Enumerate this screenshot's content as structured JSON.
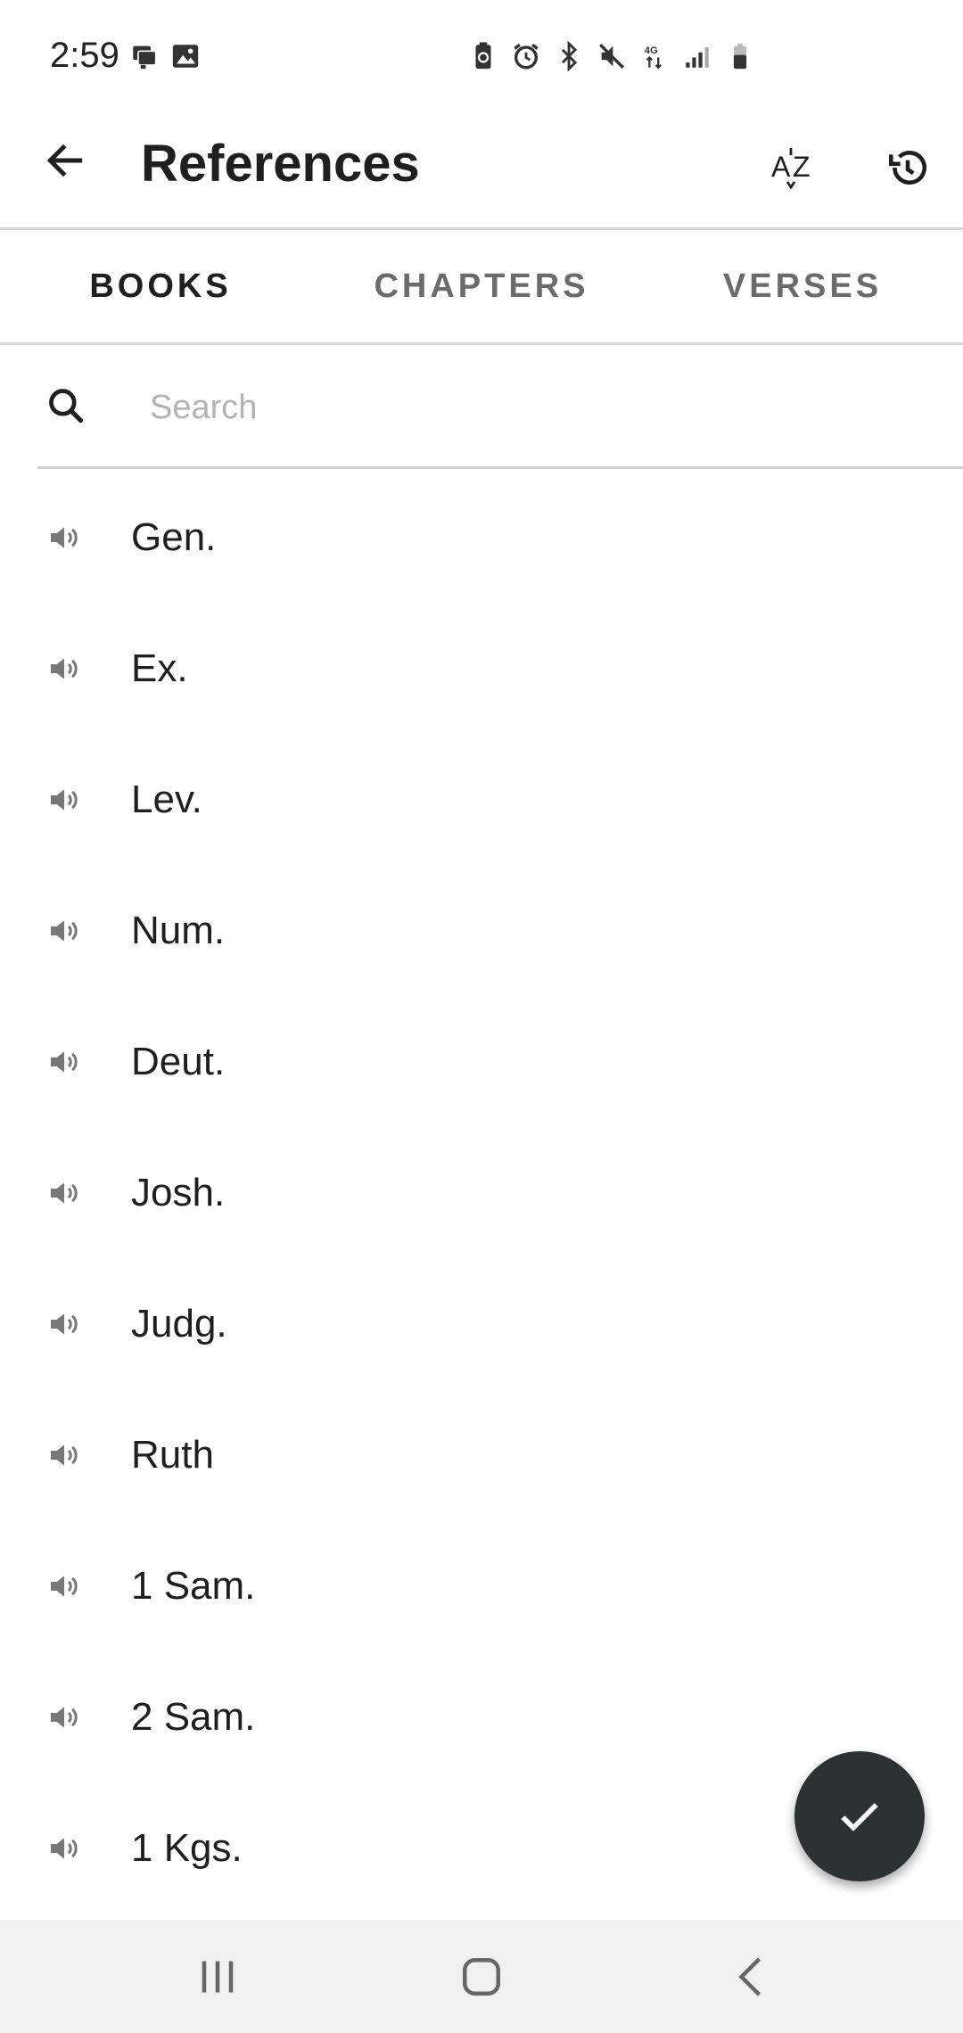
{
  "status_bar": {
    "time": "2:59",
    "left_icons": [
      "notification-icon",
      "image-icon"
    ],
    "right_icons": [
      "battery-saver-icon",
      "alarm-icon",
      "bluetooth-icon",
      "mute-icon",
      "network-4g-icon",
      "signal-icon",
      "battery-icon"
    ]
  },
  "app_bar": {
    "title": "References",
    "back_icon": "arrow-back-icon",
    "sort_icon": "sort-az-icon",
    "history_icon": "history-icon"
  },
  "tabs": [
    {
      "label": "BOOKS",
      "active": true
    },
    {
      "label": "CHAPTERS",
      "active": false
    },
    {
      "label": "VERSES",
      "active": false
    }
  ],
  "search": {
    "placeholder": "Search",
    "value": ""
  },
  "books": [
    {
      "label": "Gen."
    },
    {
      "label": "Ex."
    },
    {
      "label": "Lev."
    },
    {
      "label": "Num."
    },
    {
      "label": "Deut."
    },
    {
      "label": "Josh."
    },
    {
      "label": "Judg."
    },
    {
      "label": "Ruth"
    },
    {
      "label": "1 Sam."
    },
    {
      "label": "2 Sam."
    },
    {
      "label": "1 Kgs."
    }
  ],
  "fab": {
    "icon": "check-icon"
  },
  "colors": {
    "fab_bg": "#2d3132",
    "divider": "#d4d4d4",
    "active_tab": "#1f1f1f",
    "inactive_tab": "#6b6b6b",
    "nav_bar": "#f0f0f0"
  }
}
